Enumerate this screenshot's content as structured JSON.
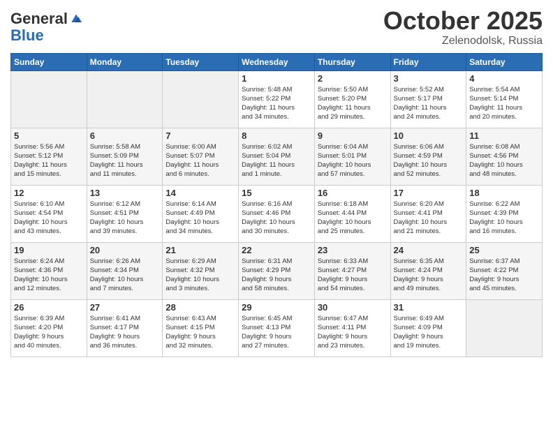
{
  "header": {
    "logo_general": "General",
    "logo_blue": "Blue",
    "month": "October 2025",
    "location": "Zelenodolsk, Russia"
  },
  "weekdays": [
    "Sunday",
    "Monday",
    "Tuesday",
    "Wednesday",
    "Thursday",
    "Friday",
    "Saturday"
  ],
  "weeks": [
    [
      {
        "day": "",
        "info": ""
      },
      {
        "day": "",
        "info": ""
      },
      {
        "day": "",
        "info": ""
      },
      {
        "day": "1",
        "info": "Sunrise: 5:48 AM\nSunset: 5:22 PM\nDaylight: 11 hours\nand 34 minutes."
      },
      {
        "day": "2",
        "info": "Sunrise: 5:50 AM\nSunset: 5:20 PM\nDaylight: 11 hours\nand 29 minutes."
      },
      {
        "day": "3",
        "info": "Sunrise: 5:52 AM\nSunset: 5:17 PM\nDaylight: 11 hours\nand 24 minutes."
      },
      {
        "day": "4",
        "info": "Sunrise: 5:54 AM\nSunset: 5:14 PM\nDaylight: 11 hours\nand 20 minutes."
      }
    ],
    [
      {
        "day": "5",
        "info": "Sunrise: 5:56 AM\nSunset: 5:12 PM\nDaylight: 11 hours\nand 15 minutes."
      },
      {
        "day": "6",
        "info": "Sunrise: 5:58 AM\nSunset: 5:09 PM\nDaylight: 11 hours\nand 11 minutes."
      },
      {
        "day": "7",
        "info": "Sunrise: 6:00 AM\nSunset: 5:07 PM\nDaylight: 11 hours\nand 6 minutes."
      },
      {
        "day": "8",
        "info": "Sunrise: 6:02 AM\nSunset: 5:04 PM\nDaylight: 11 hours\nand 1 minute."
      },
      {
        "day": "9",
        "info": "Sunrise: 6:04 AM\nSunset: 5:01 PM\nDaylight: 10 hours\nand 57 minutes."
      },
      {
        "day": "10",
        "info": "Sunrise: 6:06 AM\nSunset: 4:59 PM\nDaylight: 10 hours\nand 52 minutes."
      },
      {
        "day": "11",
        "info": "Sunrise: 6:08 AM\nSunset: 4:56 PM\nDaylight: 10 hours\nand 48 minutes."
      }
    ],
    [
      {
        "day": "12",
        "info": "Sunrise: 6:10 AM\nSunset: 4:54 PM\nDaylight: 10 hours\nand 43 minutes."
      },
      {
        "day": "13",
        "info": "Sunrise: 6:12 AM\nSunset: 4:51 PM\nDaylight: 10 hours\nand 39 minutes."
      },
      {
        "day": "14",
        "info": "Sunrise: 6:14 AM\nSunset: 4:49 PM\nDaylight: 10 hours\nand 34 minutes."
      },
      {
        "day": "15",
        "info": "Sunrise: 6:16 AM\nSunset: 4:46 PM\nDaylight: 10 hours\nand 30 minutes."
      },
      {
        "day": "16",
        "info": "Sunrise: 6:18 AM\nSunset: 4:44 PM\nDaylight: 10 hours\nand 25 minutes."
      },
      {
        "day": "17",
        "info": "Sunrise: 6:20 AM\nSunset: 4:41 PM\nDaylight: 10 hours\nand 21 minutes."
      },
      {
        "day": "18",
        "info": "Sunrise: 6:22 AM\nSunset: 4:39 PM\nDaylight: 10 hours\nand 16 minutes."
      }
    ],
    [
      {
        "day": "19",
        "info": "Sunrise: 6:24 AM\nSunset: 4:36 PM\nDaylight: 10 hours\nand 12 minutes."
      },
      {
        "day": "20",
        "info": "Sunrise: 6:26 AM\nSunset: 4:34 PM\nDaylight: 10 hours\nand 7 minutes."
      },
      {
        "day": "21",
        "info": "Sunrise: 6:29 AM\nSunset: 4:32 PM\nDaylight: 10 hours\nand 3 minutes."
      },
      {
        "day": "22",
        "info": "Sunrise: 6:31 AM\nSunset: 4:29 PM\nDaylight: 9 hours\nand 58 minutes."
      },
      {
        "day": "23",
        "info": "Sunrise: 6:33 AM\nSunset: 4:27 PM\nDaylight: 9 hours\nand 54 minutes."
      },
      {
        "day": "24",
        "info": "Sunrise: 6:35 AM\nSunset: 4:24 PM\nDaylight: 9 hours\nand 49 minutes."
      },
      {
        "day": "25",
        "info": "Sunrise: 6:37 AM\nSunset: 4:22 PM\nDaylight: 9 hours\nand 45 minutes."
      }
    ],
    [
      {
        "day": "26",
        "info": "Sunrise: 6:39 AM\nSunset: 4:20 PM\nDaylight: 9 hours\nand 40 minutes."
      },
      {
        "day": "27",
        "info": "Sunrise: 6:41 AM\nSunset: 4:17 PM\nDaylight: 9 hours\nand 36 minutes."
      },
      {
        "day": "28",
        "info": "Sunrise: 6:43 AM\nSunset: 4:15 PM\nDaylight: 9 hours\nand 32 minutes."
      },
      {
        "day": "29",
        "info": "Sunrise: 6:45 AM\nSunset: 4:13 PM\nDaylight: 9 hours\nand 27 minutes."
      },
      {
        "day": "30",
        "info": "Sunrise: 6:47 AM\nSunset: 4:11 PM\nDaylight: 9 hours\nand 23 minutes."
      },
      {
        "day": "31",
        "info": "Sunrise: 6:49 AM\nSunset: 4:09 PM\nDaylight: 9 hours\nand 19 minutes."
      },
      {
        "day": "",
        "info": ""
      }
    ]
  ]
}
